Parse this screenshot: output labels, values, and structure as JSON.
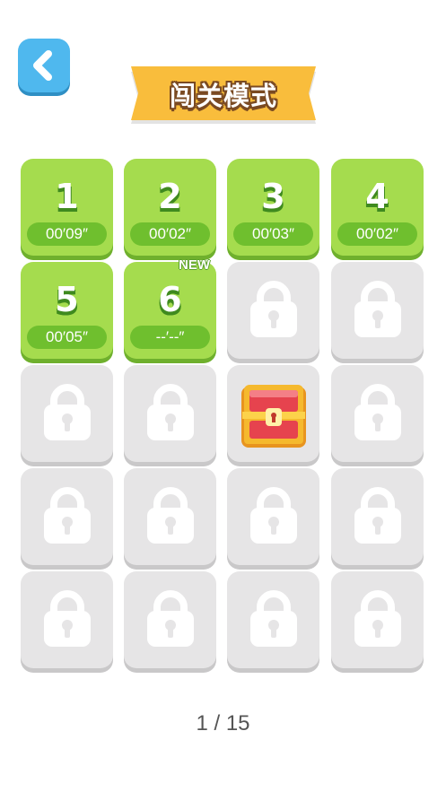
{
  "header": {
    "title": "闯关模式",
    "back_icon": "chevron-left-icon"
  },
  "levels": [
    {
      "number": "1",
      "time": "00′09″",
      "state": "completed"
    },
    {
      "number": "2",
      "time": "00′02″",
      "state": "completed"
    },
    {
      "number": "3",
      "time": "00′03″",
      "state": "completed"
    },
    {
      "number": "4",
      "time": "00′02″",
      "state": "completed"
    },
    {
      "number": "5",
      "time": "00′05″",
      "state": "completed"
    },
    {
      "number": "6",
      "time": "--′--″",
      "state": "current",
      "badge": "NEW"
    },
    {
      "state": "locked"
    },
    {
      "state": "locked"
    },
    {
      "state": "locked"
    },
    {
      "state": "locked"
    },
    {
      "state": "reward",
      "icon": "treasure-chest-icon"
    },
    {
      "state": "locked"
    },
    {
      "state": "locked"
    },
    {
      "state": "locked"
    },
    {
      "state": "locked"
    },
    {
      "state": "locked"
    },
    {
      "state": "locked"
    },
    {
      "state": "locked"
    },
    {
      "state": "locked"
    },
    {
      "state": "locked"
    }
  ],
  "pager": {
    "text": "1 / 15"
  },
  "colors": {
    "completed": "#a5dc4e",
    "locked": "#e6e5e6",
    "back_button": "#4fb8ee",
    "banner": "#f9bd3c"
  }
}
